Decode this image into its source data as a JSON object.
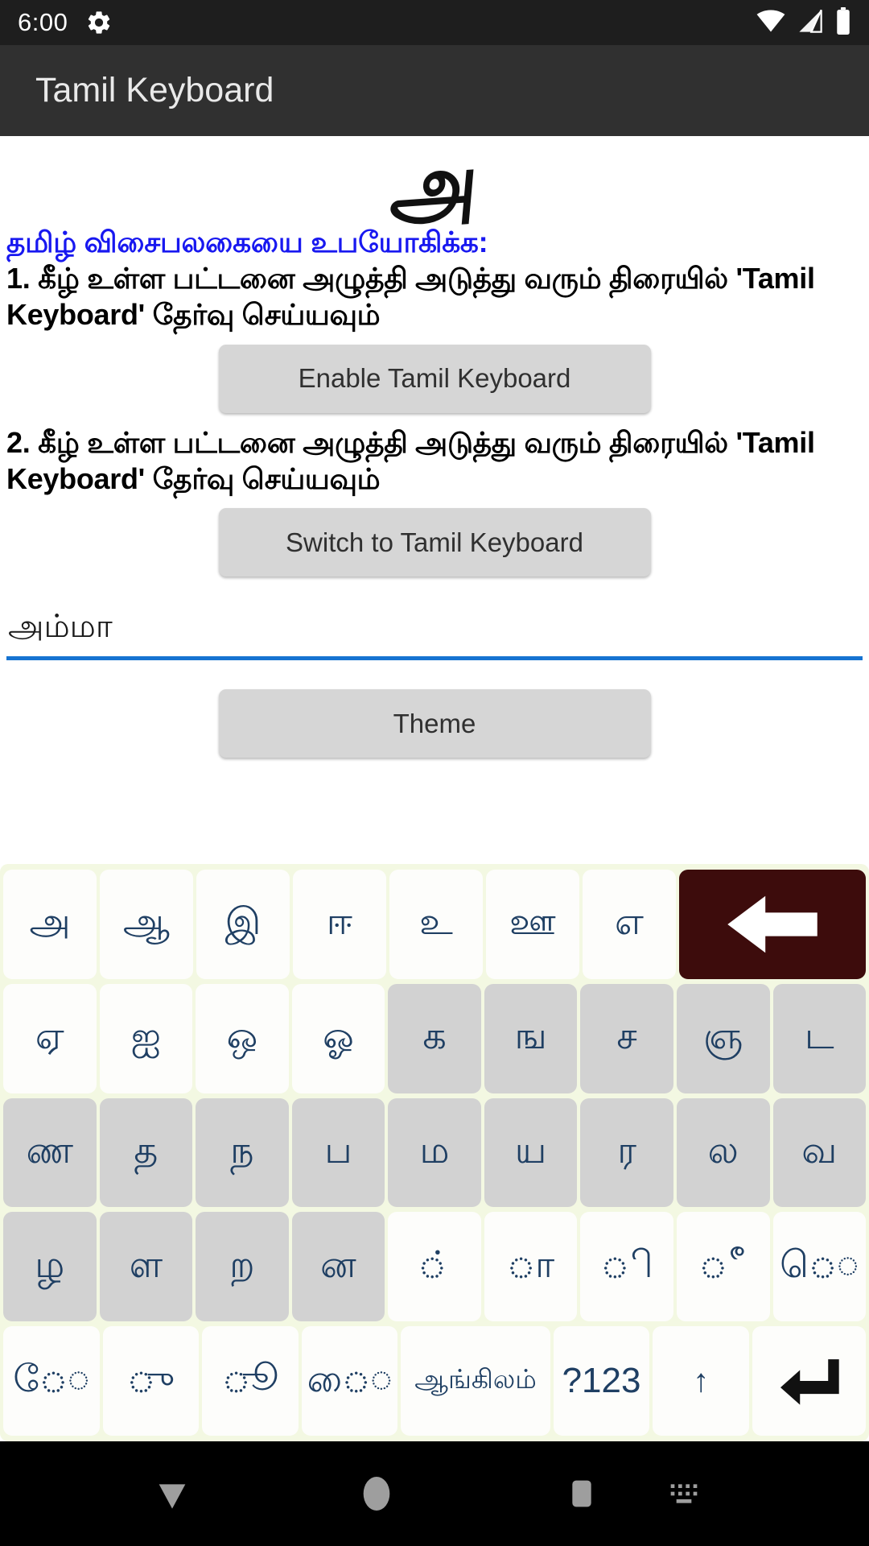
{
  "status_bar": {
    "clock": "6:00",
    "icons": [
      "gear-icon",
      "wifi-icon",
      "cellular-signal-icon",
      "battery-icon"
    ]
  },
  "app_bar": {
    "title": "Tamil Keyboard"
  },
  "colors": {
    "status_bar_bg": "#1e1e1e",
    "app_bar_bg": "#303030",
    "heading_blue": "#1818f0",
    "input_underline": "#1673d1",
    "keyboard_bg": "#f3f8e2",
    "key_text": "#1f3f63",
    "key_white": "#fdfdfb",
    "key_gray": "#d2d2d2",
    "backspace_bg": "#3d0c0c",
    "button_bg": "#d6d6d6"
  },
  "main": {
    "logo_glyph": "அ",
    "heading": "தமிழ் விசைபலகையை உபயோகிக்க:",
    "instruction_1": "1. கீழ் உள்ள பட்டனை அழுத்தி அடுத்து வரும் திரையில் 'Tamil Keyboard' தேர்வு செய்யவும்",
    "enable_button": "Enable Tamil Keyboard",
    "instruction_2": "2. கீழ் உள்ள பட்டனை அழுத்தி அடுத்து வரும் திரையில் 'Tamil Keyboard' தேர்வு செய்யவும்",
    "switch_button": "Switch to Tamil Keyboard",
    "text_field_value": "அம்மா",
    "text_field_placeholder": "",
    "theme_button": "Theme"
  },
  "keyboard": {
    "rows": [
      [
        {
          "label": "அ",
          "name": "key-a",
          "style": "white"
        },
        {
          "label": "ஆ",
          "name": "key-aa",
          "style": "white"
        },
        {
          "label": "இ",
          "name": "key-i",
          "style": "white"
        },
        {
          "label": "ஈ",
          "name": "key-ii",
          "style": "white"
        },
        {
          "label": "உ",
          "name": "key-u",
          "style": "white"
        },
        {
          "label": "ஊ",
          "name": "key-uu",
          "style": "white"
        },
        {
          "label": "எ",
          "name": "key-e",
          "style": "white"
        },
        {
          "label": "",
          "name": "key-backspace",
          "style": "back"
        }
      ],
      [
        {
          "label": "ஏ",
          "name": "key-ee",
          "style": "white"
        },
        {
          "label": "ஐ",
          "name": "key-ai",
          "style": "white"
        },
        {
          "label": "ஒ",
          "name": "key-o",
          "style": "white"
        },
        {
          "label": "ஓ",
          "name": "key-oo",
          "style": "white"
        },
        {
          "label": "க",
          "name": "key-ka",
          "style": "gray"
        },
        {
          "label": "ங",
          "name": "key-nga",
          "style": "gray"
        },
        {
          "label": "ச",
          "name": "key-ca",
          "style": "gray"
        },
        {
          "label": "ஞ",
          "name": "key-nya",
          "style": "gray"
        },
        {
          "label": "ட",
          "name": "key-tta",
          "style": "gray"
        }
      ],
      [
        {
          "label": "ண",
          "name": "key-nna",
          "style": "gray"
        },
        {
          "label": "த",
          "name": "key-tha",
          "style": "gray"
        },
        {
          "label": "ந",
          "name": "key-na",
          "style": "gray"
        },
        {
          "label": "ப",
          "name": "key-pa",
          "style": "gray"
        },
        {
          "label": "ம",
          "name": "key-ma",
          "style": "gray"
        },
        {
          "label": "ய",
          "name": "key-ya",
          "style": "gray"
        },
        {
          "label": "ர",
          "name": "key-ra",
          "style": "gray"
        },
        {
          "label": "ல",
          "name": "key-la",
          "style": "gray"
        },
        {
          "label": "வ",
          "name": "key-va",
          "style": "gray"
        }
      ],
      [
        {
          "label": "ழ",
          "name": "key-zha",
          "style": "gray"
        },
        {
          "label": "ள",
          "name": "key-lla",
          "style": "gray"
        },
        {
          "label": "ற",
          "name": "key-rra",
          "style": "gray"
        },
        {
          "label": "ன",
          "name": "key-nnna",
          "style": "gray"
        },
        {
          "label": "◌்",
          "name": "key-sign-pulli",
          "style": "white"
        },
        {
          "label": "◌ா",
          "name": "key-sign-aa",
          "style": "white"
        },
        {
          "label": "◌ி",
          "name": "key-sign-i",
          "style": "white"
        },
        {
          "label": "◌ீ",
          "name": "key-sign-ii",
          "style": "white"
        },
        {
          "label": "ெ◌",
          "name": "key-sign-e",
          "style": "white"
        }
      ],
      [
        {
          "label": "ே◌",
          "name": "key-sign-ee",
          "style": "white"
        },
        {
          "label": "◌ு",
          "name": "key-sign-u",
          "style": "white"
        },
        {
          "label": "◌ூ",
          "name": "key-sign-uu",
          "style": "white"
        },
        {
          "label": "ை◌",
          "name": "key-sign-ai",
          "style": "white"
        },
        {
          "label": "ஆங்கிலம்",
          "name": "key-language-english",
          "style": "white wide15 small"
        },
        {
          "label": "?123",
          "name": "key-symbols",
          "style": "white num"
        },
        {
          "label": "↑",
          "name": "key-shift",
          "style": "white shift"
        },
        {
          "label": "",
          "name": "key-enter",
          "style": "white wide12 enter"
        }
      ]
    ]
  },
  "nav_bar": {
    "items": [
      {
        "name": "nav-back-icon"
      },
      {
        "name": "nav-home-icon"
      },
      {
        "name": "nav-recents-icon"
      },
      {
        "name": "nav-keyboard-switch-icon"
      }
    ]
  }
}
